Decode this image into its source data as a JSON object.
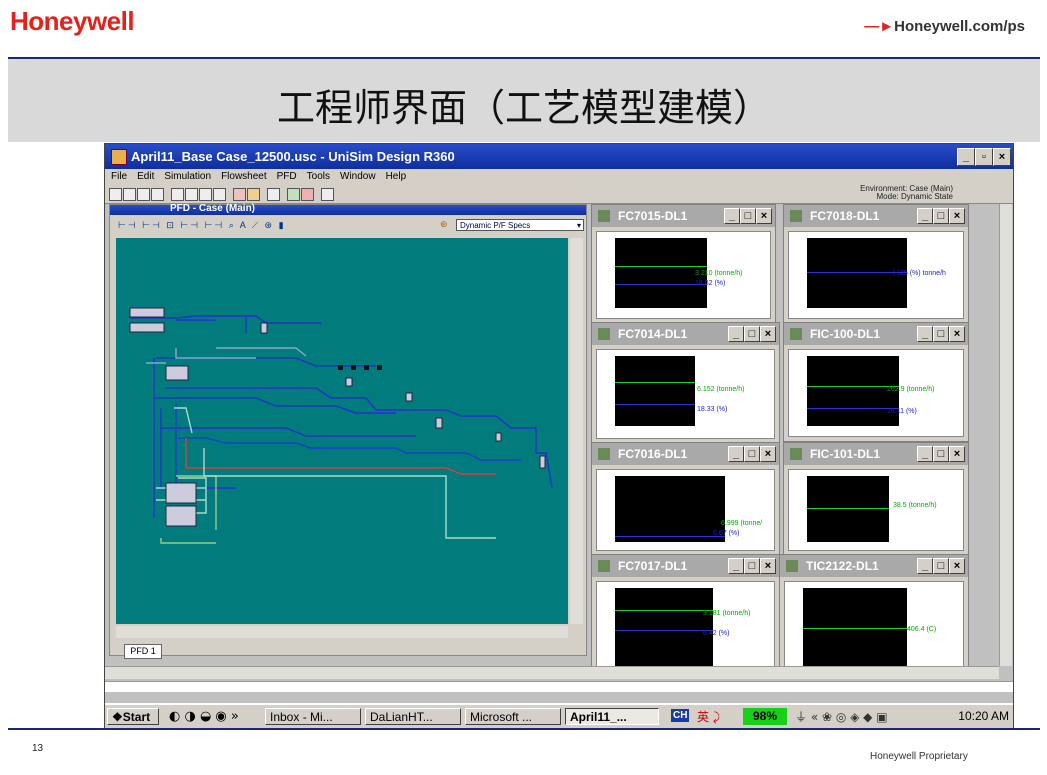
{
  "slide": {
    "logo": "Honeywell",
    "site": "Honeywell.com/ps",
    "title": "工程师界面（工艺模型建模）",
    "slide_number": "13",
    "footer": "Honeywell Proprietary"
  },
  "window": {
    "title": "April11_Base Case_12500.usc - UniSim Design R360",
    "min": "_",
    "max": "▫",
    "close": "×"
  },
  "menu": [
    "File",
    "Edit",
    "Simulation",
    "Flowsheet",
    "PFD",
    "Tools",
    "Window",
    "Help"
  ],
  "environment": {
    "line1": "Environment: Case (Main)",
    "line2": "Mode: Dynamic State"
  },
  "pfd": {
    "header": "PFD - Case (Main)",
    "dynamic_select": "Dynamic P/F Specs",
    "tab": "PFD 1"
  },
  "charts": [
    {
      "name": "FC7015-DL1",
      "v1": "3.210 (tonne/h)",
      "v2": "18.82 (%)"
    },
    {
      "name": "FC7018-DL1",
      "v1": "",
      "v2": "(-)25 (%) tonne/h"
    },
    {
      "name": "FC7014-DL1",
      "v1": "6.152 (tonne/h)",
      "v2": "18.33 (%)"
    },
    {
      "name": "FIC-100-DL1",
      "v1": "262.9 (tonne/h)",
      "v2": "16.11 (%)"
    },
    {
      "name": "FC7016-DL1",
      "v1": "6.999 (tonne/",
      "v2": "6.67 (%)"
    },
    {
      "name": "FIC-101-DL1",
      "v1": "38.5 (tonne/h)",
      "v2": ""
    },
    {
      "name": "FC7017-DL1",
      "v1": "3.181 (tonne/h)",
      "v2": "6.42 (%)"
    },
    {
      "name": "TIC2122-DL1",
      "v1": "406.4 (C)",
      "v2": ""
    }
  ],
  "chart_buttons": {
    "min": "_",
    "max": "□",
    "close": "×"
  },
  "taskbar": {
    "start": "Start",
    "items": [
      "Inbox - Mi...",
      "DaLianHT...",
      "Microsoft ...",
      "April11_..."
    ],
    "lang": "CH",
    "battery": "98%",
    "clock": "10:20 AM"
  },
  "colors": {
    "brand_red": "#e1231b",
    "pfd_background": "#017b7b",
    "title_blue": "#0d2f9e"
  }
}
